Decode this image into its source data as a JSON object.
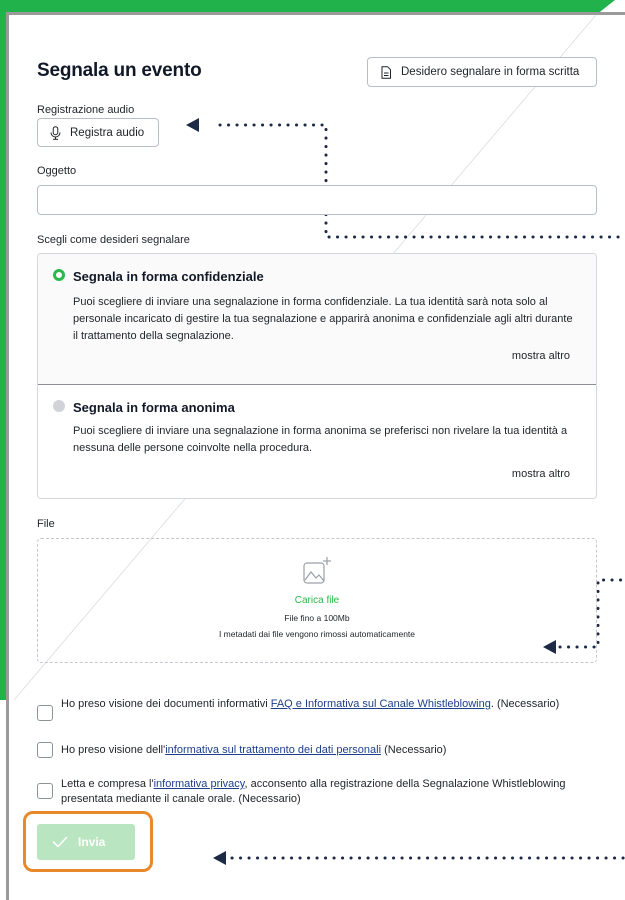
{
  "form": {
    "title": "Segnala un evento",
    "write_button": "Desidero segnalare in forma scritta",
    "audio_label": "Registrazione audio",
    "audio_button": "Registra audio",
    "subject_label": "Oggetto",
    "subject_value": "",
    "mode_label": "Scegli come desideri segnalare",
    "file_label": "File",
    "submit_label": "Invia"
  },
  "modes": [
    {
      "title": "Segnala in forma confidenziale",
      "description": "Puoi scegliere di inviare una segnalazione in forma confidenziale. La tua identità sarà nota solo al personale incaricato di gestire la tua segnalazione e apparirà anonima e confidenziale agli altri durante il trattamento della segnalazione.",
      "more": "mostra altro",
      "selected": true
    },
    {
      "title": "Segnala in forma anonima",
      "description": "Puoi scegliere di inviare una segnalazione in forma anonima se preferisci non rivelare la tua identità a nessuna delle persone coinvolte nella procedura.",
      "more": "mostra altro",
      "selected": false
    }
  ],
  "upload": {
    "action": "Carica file",
    "size_limit": "File fino a 100Mb",
    "metadata_note": "I metadati dai file vengono rimossi automaticamente"
  },
  "consents": [
    {
      "before": "Ho preso visione dei documenti informativi ",
      "link": "FAQ e Informativa sul Canale Whistleblowing",
      "after": ". (Necessario)",
      "checked": false
    },
    {
      "before": "Ho preso visione dell'",
      "link": "informativa sul trattamento dei dati personali",
      "after": " (Necessario)",
      "checked": false
    },
    {
      "before": "Letta e compresa l'",
      "link": "informativa privacy",
      "after": ", acconsento alla registrazione della Segnalazione Whistleblowing presentata mediante il canale orale. (Necessario)",
      "checked": false
    }
  ],
  "colors": {
    "brand_green": "#2eb84c",
    "submit_disabled": "#b9e5c1",
    "highlight_orange": "#e8892b",
    "link_blue": "#1d3f8c"
  },
  "icons": {
    "write": "document-icon",
    "audio": "microphone-icon",
    "upload": "image-upload-icon",
    "submit": "checkmark-icon"
  }
}
